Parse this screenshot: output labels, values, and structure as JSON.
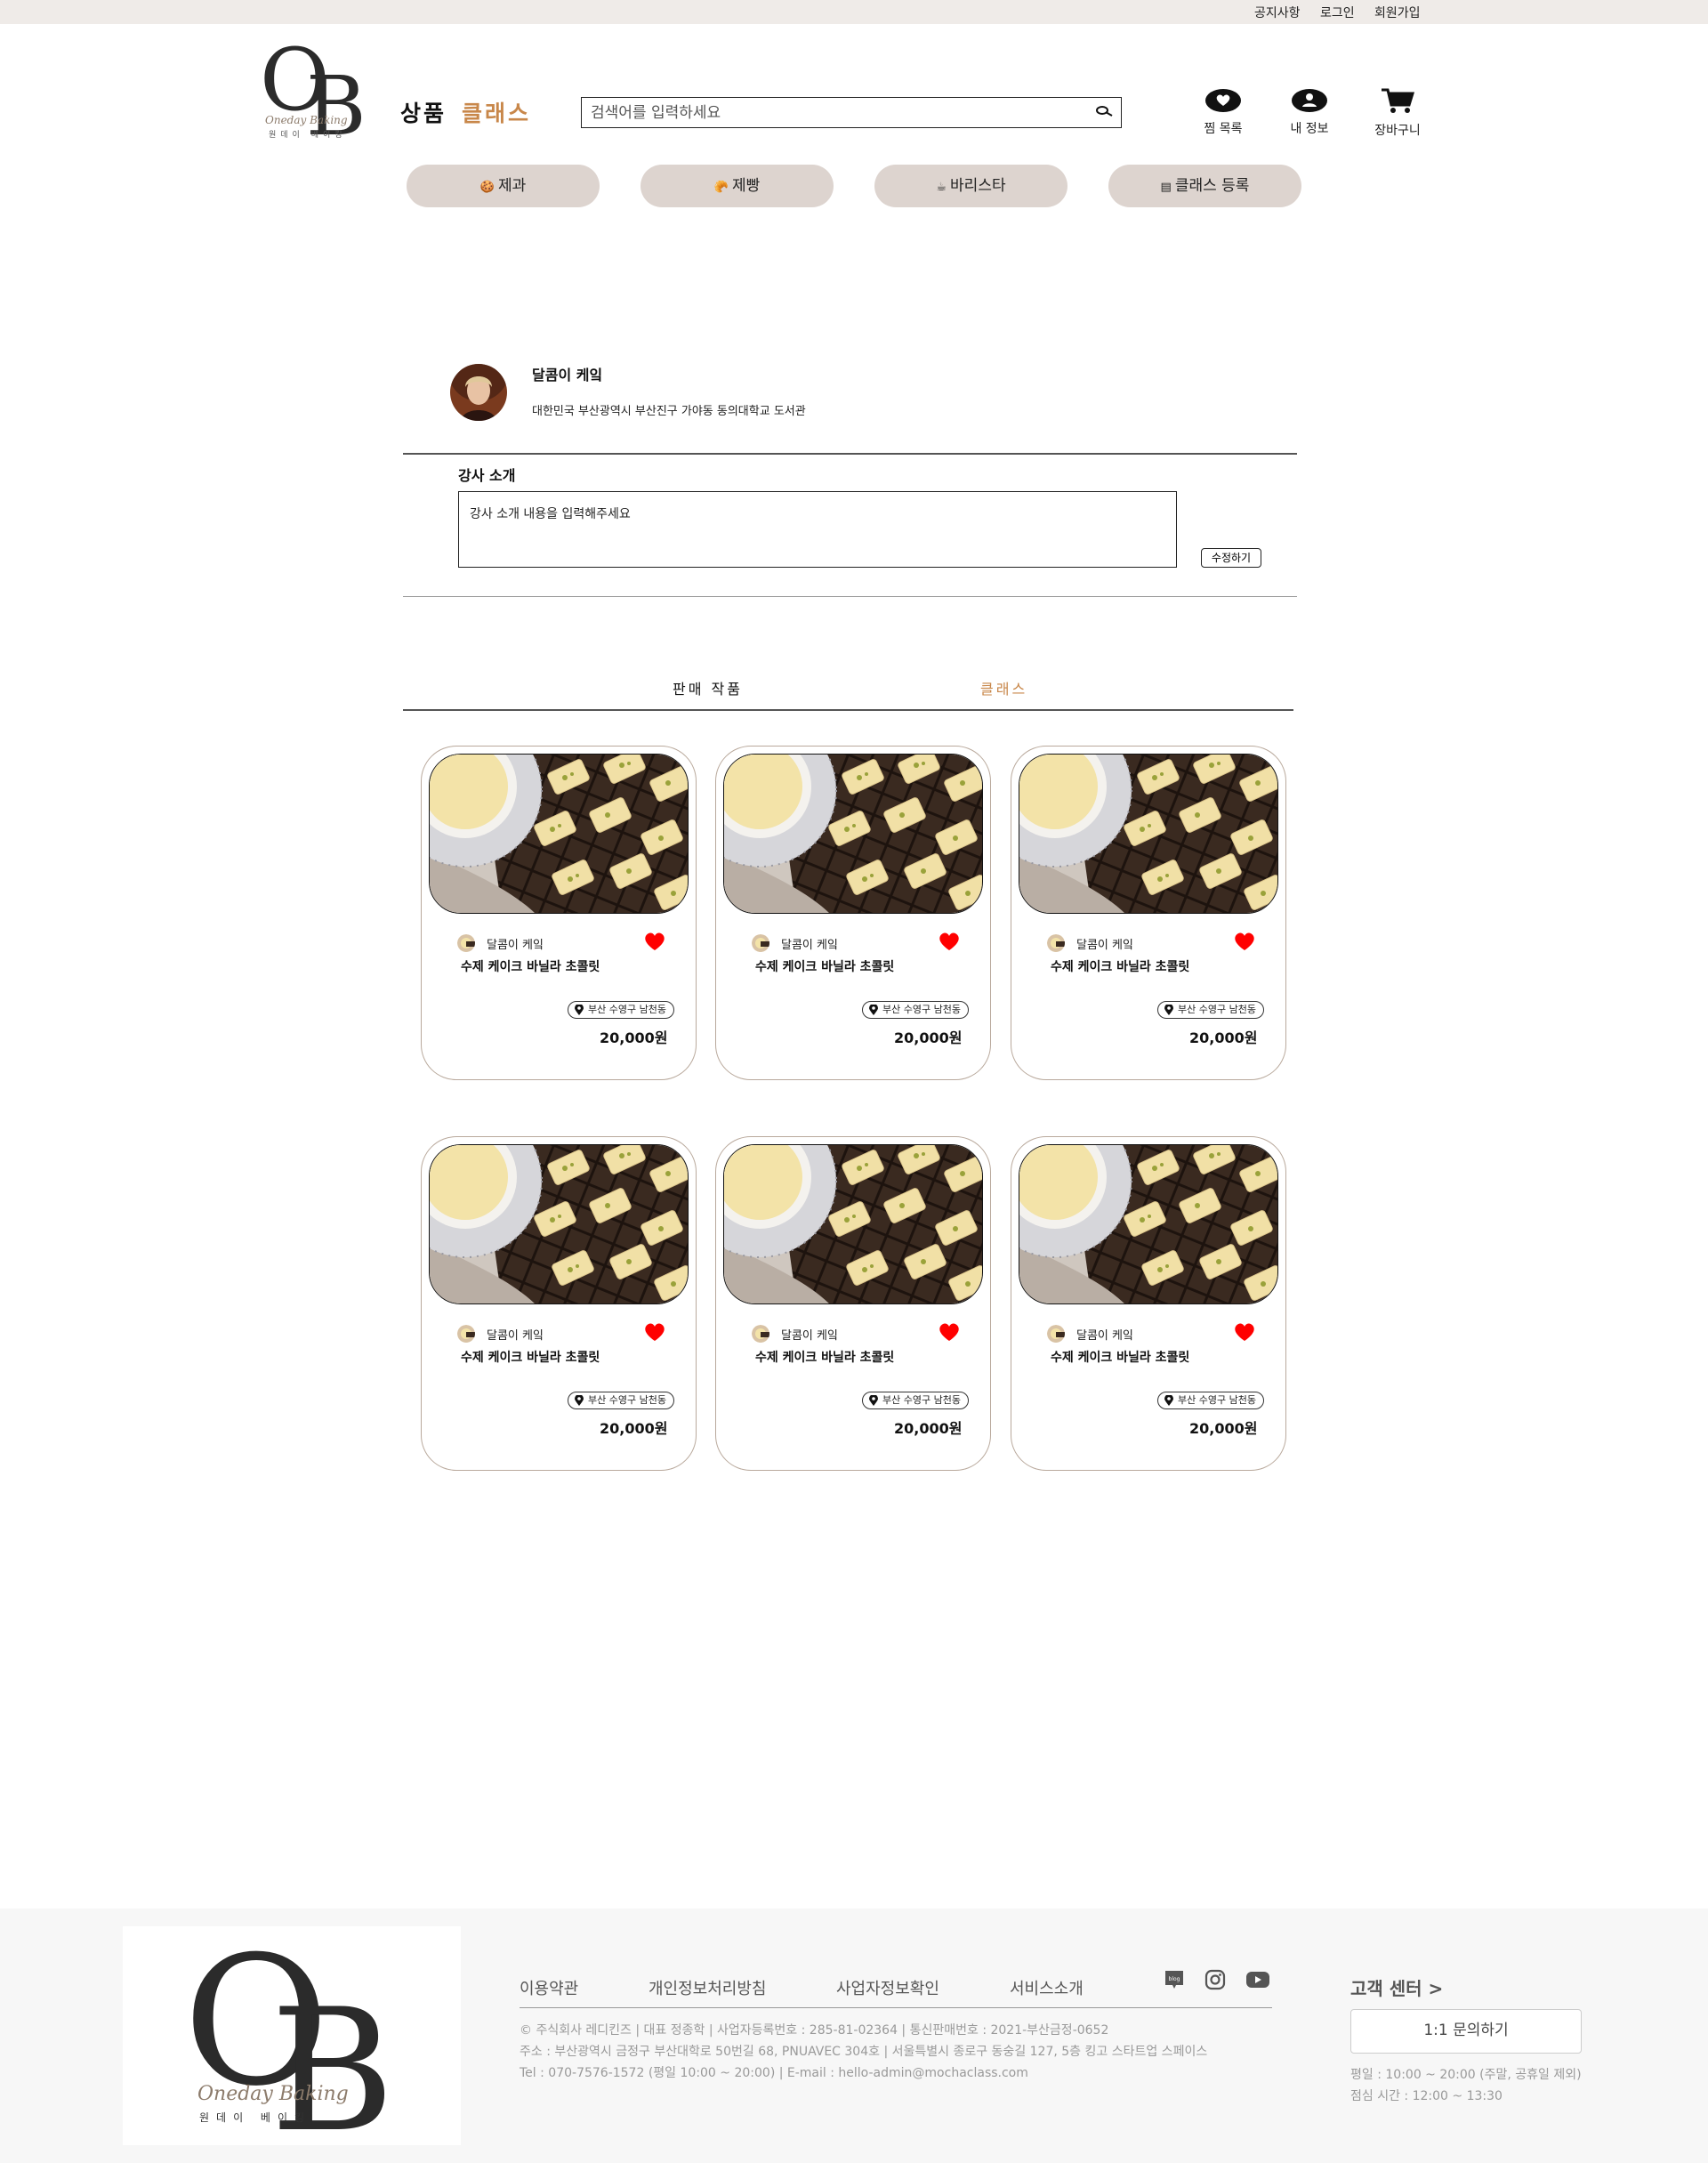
{
  "topbar": {
    "notice": "공지사항",
    "login": "로그인",
    "signup": "회원가입"
  },
  "header": {
    "logo": {
      "letter_o": "O",
      "letter_b": "B",
      "script": "Oneday Baking",
      "sub": "원데이 베이킹"
    },
    "nav_products": "상품",
    "nav_classes": "클래스",
    "search_placeholder": "검색어를 입력하세요",
    "wishlist": "찜 목록",
    "my_info": "내 정보",
    "cart": "장바구니"
  },
  "categories": [
    {
      "icon": "🍪",
      "label": "제과"
    },
    {
      "icon": "🥐",
      "label": "제빵"
    },
    {
      "icon": "☕",
      "label": "바리스타"
    },
    {
      "icon": "▤",
      "label": "클래스 등록"
    }
  ],
  "profile": {
    "name": "달콤이 케잌",
    "address": "대한민국 부산광역시 부산진구 가야동 동의대학교 도서관",
    "intro_title": "강사 소개",
    "intro_placeholder": "강사 소개 내용을 입력해주세요",
    "edit_button": "수정하기"
  },
  "tabs": {
    "sales": "판매 작품",
    "classes": "클래스"
  },
  "cards": [
    {
      "shop": "달콤이 케잌",
      "title": "수제 케이크 바닐라 초콜릿",
      "location": "부산 수영구 남천동",
      "price": "20,000원"
    },
    {
      "shop": "달콤이 케잌",
      "title": "수제 케이크 바닐라 초콜릿",
      "location": "부산 수영구 남천동",
      "price": "20,000원"
    },
    {
      "shop": "달콤이 케잌",
      "title": "수제 케이크 바닐라 초콜릿",
      "location": "부산 수영구 남천동",
      "price": "20,000원"
    },
    {
      "shop": "달콤이 케잌",
      "title": "수제 케이크 바닐라 초콜릿",
      "location": "부산 수영구 남천동",
      "price": "20,000원"
    },
    {
      "shop": "달콤이 케잌",
      "title": "수제 케이크 바닐라 초콜릿",
      "location": "부산 수영구 남천동",
      "price": "20,000원"
    },
    {
      "shop": "달콤이 케잌",
      "title": "수제 케이크 바닐라 초콜릿",
      "location": "부산 수영구 남천동",
      "price": "20,000원"
    }
  ],
  "footer": {
    "logo": {
      "letter_o": "O",
      "letter_b": "B",
      "script": "Oneday Baking",
      "sub": "원데이 베이킹"
    },
    "links": {
      "terms": "이용약관",
      "privacy": "개인정보처리방침",
      "business_info": "사업자정보확인",
      "service": "서비스소개"
    },
    "social": {
      "blog": "blog"
    },
    "info_line1": "© 주식회사 레디킨즈 | 대표 정종학 | 사업자등록번호 : 285-81-02364 | 통신판매번호 : 2021-부산금정-0652",
    "info_line2": "주소 : 부산광역시 금정구 부산대학로 50번길 68, PNUAVEC 304호 | 서울특별시 종로구 동숭길 127, 5층 킹고 스타트업 스페이스",
    "info_line3": "Tel : 070-7576-1572 (평일 10:00 ~ 20:00) | E-mail : hello-admin@mochaclass.com",
    "cs_title": "고객 센터 >",
    "cs_button": "1:1 문의하기",
    "hours_weekday": "평일 : 10:00 ~ 20:00 (주말, 공휴일 제외)",
    "hours_lunch": "점심 시간 : 12:00 ~ 13:30"
  },
  "colors": {
    "accent": "#c8874a",
    "category_bg": "#ddd4cf",
    "topbar_bg": "#efebe8",
    "heart": "#ff0000",
    "card_border": "#b9a99c"
  },
  "icons": [
    "search-icon",
    "heart-icon",
    "user-icon",
    "cart-icon",
    "location-pin-icon",
    "blog-icon",
    "instagram-icon",
    "youtube-icon"
  ]
}
